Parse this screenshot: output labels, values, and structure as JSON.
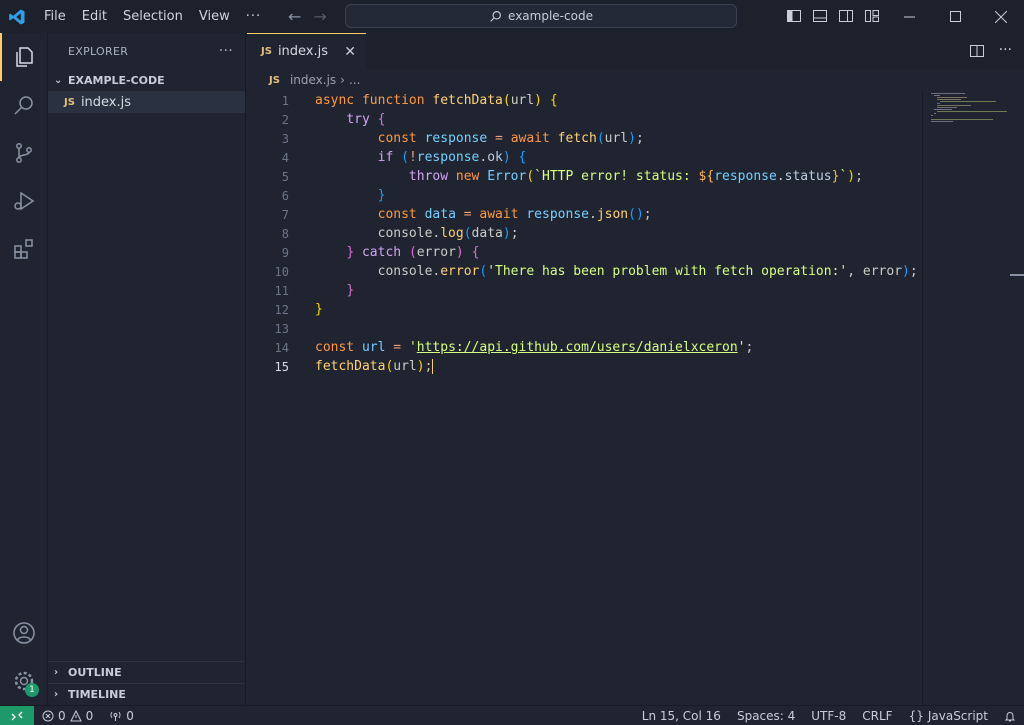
{
  "menu": {
    "items": [
      "File",
      "Edit",
      "Selection",
      "View"
    ],
    "more": "···"
  },
  "search": {
    "text": "example-code"
  },
  "explorer": {
    "title": "EXPLORER",
    "more": "···",
    "folder": "EXAMPLE-CODE",
    "files": [
      {
        "icon": "JS",
        "name": "index.js"
      }
    ],
    "outline": "OUTLINE",
    "timeline": "TIMELINE"
  },
  "editor": {
    "tab": {
      "icon": "JS",
      "label": "index.js",
      "close": "✕"
    },
    "breadcrumb": {
      "icon": "JS",
      "file": "index.js",
      "sep": "›",
      "more": "..."
    },
    "line_numbers": [
      "1",
      "2",
      "3",
      "4",
      "5",
      "6",
      "7",
      "8",
      "9",
      "10",
      "11",
      "12",
      "13",
      "14",
      "15"
    ]
  },
  "activity": {
    "badge": "1"
  },
  "status": {
    "errors": "0",
    "warnings": "0",
    "ports": "0",
    "position": "Ln 15, Col 16",
    "spaces": "Spaces: 4",
    "encoding": "UTF-8",
    "eol": "CRLF",
    "language_icon": "{}",
    "language": "JavaScript"
  },
  "colors": {
    "accent": "#ffcc66",
    "remote": "#1e9a6a",
    "background": "#1f2430"
  }
}
